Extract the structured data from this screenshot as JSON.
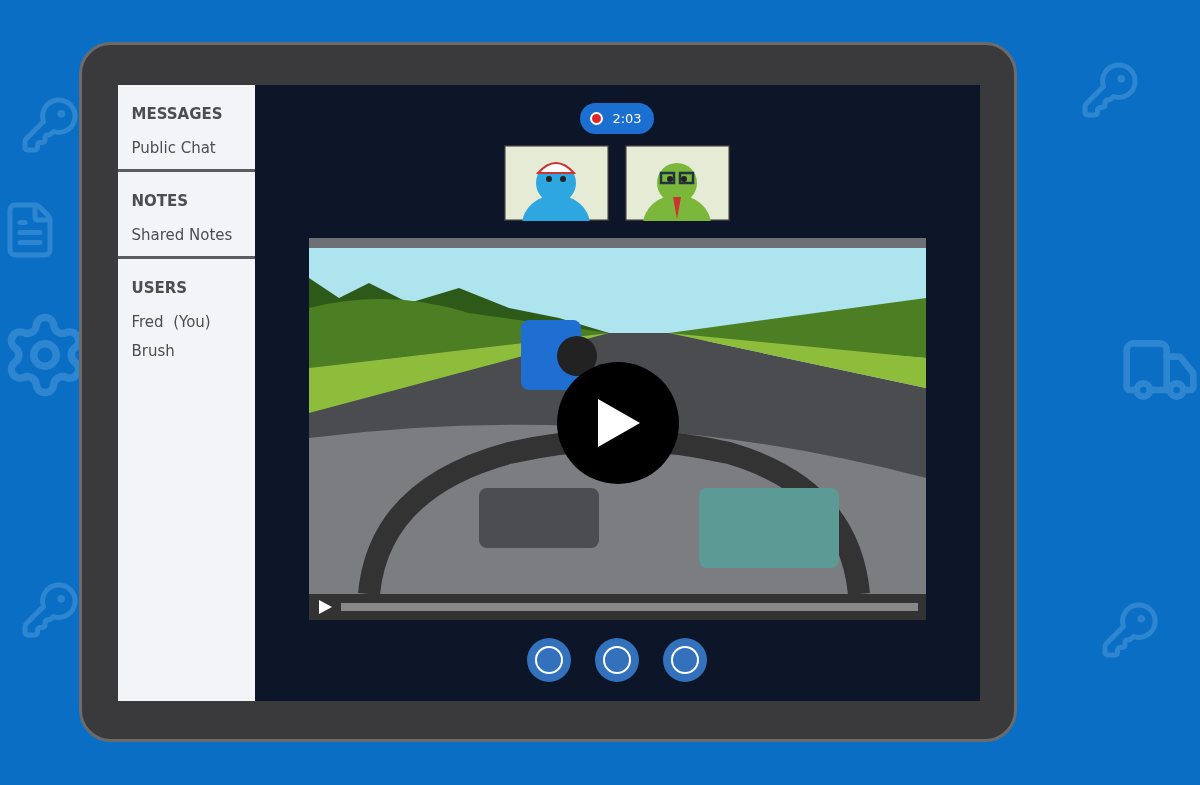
{
  "sidebar": {
    "sections": [
      {
        "heading": "MESSAGES",
        "items": [
          {
            "label": "Public Chat"
          }
        ]
      },
      {
        "heading": "NOTES",
        "items": [
          {
            "label": "Shared Notes"
          }
        ]
      },
      {
        "heading": "USERS",
        "items": [
          {
            "label": "Fred  (You)"
          },
          {
            "label": "Brush"
          }
        ]
      }
    ]
  },
  "recording": {
    "on": true,
    "time": "2:03"
  },
  "webcams": [
    {
      "kind": "blue-monster"
    },
    {
      "kind": "green-monster"
    }
  ],
  "video": {
    "playing": false,
    "level": 0
  },
  "controls": [
    {
      "kind": "ring"
    },
    {
      "kind": "ring"
    },
    {
      "kind": "ring"
    }
  ]
}
